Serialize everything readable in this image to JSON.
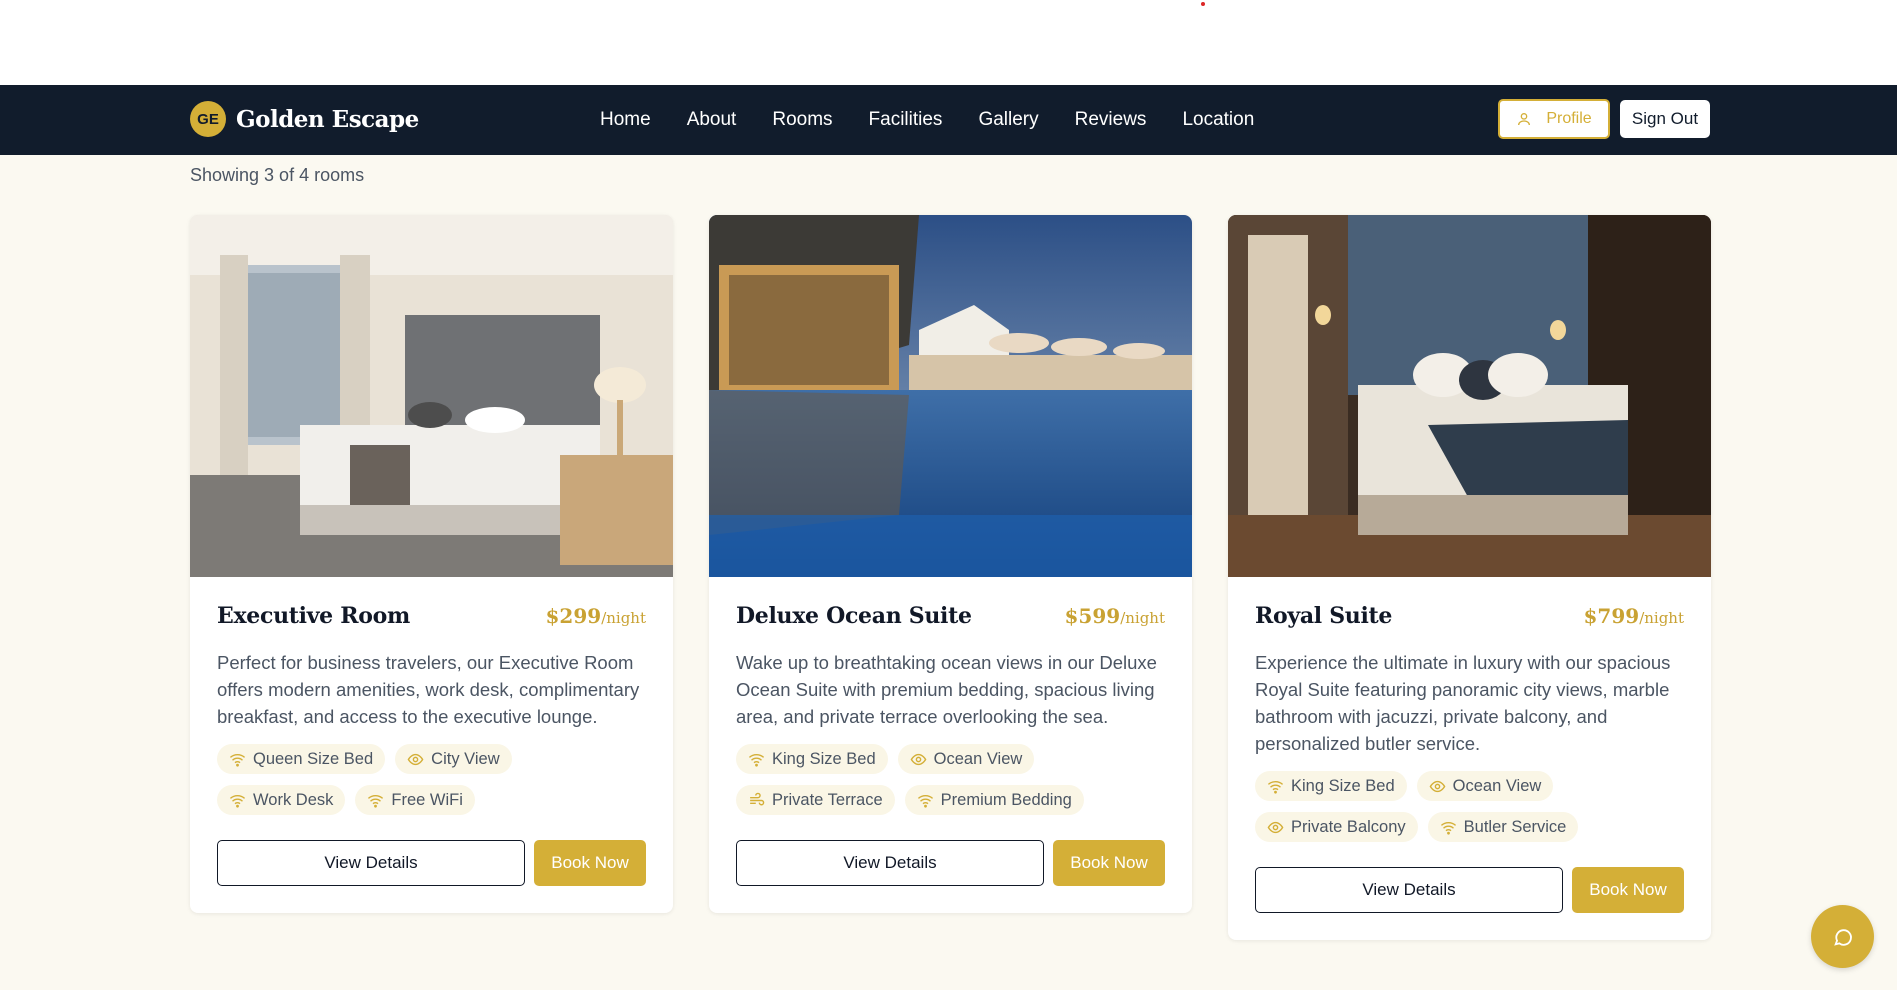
{
  "brand": {
    "badge": "GE",
    "name": "Golden Escape"
  },
  "nav": {
    "links": [
      "Home",
      "About",
      "Rooms",
      "Facilities",
      "Gallery",
      "Reviews",
      "Location"
    ],
    "profile_label": "Profile",
    "signout_label": "Sign Out"
  },
  "listing": {
    "count_text": "Showing 3 of 4 rooms",
    "rooms": [
      {
        "title": "Executive Room",
        "price": "$299",
        "price_unit": "/night",
        "description": "Perfect for business travelers, our Executive Room offers modern amenities, work desk, complimentary breakfast, and access to the executive lounge.",
        "amenities": [
          {
            "label": "Queen Size Bed",
            "icon": "wifi-icon"
          },
          {
            "label": "City View",
            "icon": "eye-icon"
          },
          {
            "label": "Work Desk",
            "icon": "wifi-icon"
          },
          {
            "label": "Free WiFi",
            "icon": "wifi-icon"
          }
        ],
        "view_label": "View Details",
        "book_label": "Book Now"
      },
      {
        "title": "Deluxe Ocean Suite",
        "price": "$599",
        "price_unit": "/night",
        "description": "Wake up to breathtaking ocean views in our Deluxe Ocean Suite with premium bedding, spacious living area, and private terrace overlooking the sea.",
        "amenities": [
          {
            "label": "King Size Bed",
            "icon": "wifi-icon"
          },
          {
            "label": "Ocean View",
            "icon": "eye-icon"
          },
          {
            "label": "Private Terrace",
            "icon": "wind-icon"
          },
          {
            "label": "Premium Bedding",
            "icon": "wifi-icon"
          }
        ],
        "view_label": "View Details",
        "book_label": "Book Now"
      },
      {
        "title": "Royal Suite",
        "price": "$799",
        "price_unit": "/night",
        "description": "Experience the ultimate in luxury with our spacious Royal Suite featuring panoramic city views, marble bathroom with jacuzzi, private balcony, and personalized butler service.",
        "amenities": [
          {
            "label": "King Size Bed",
            "icon": "wifi-icon"
          },
          {
            "label": "Ocean View",
            "icon": "eye-icon"
          },
          {
            "label": "Private Balcony",
            "icon": "eye-icon"
          },
          {
            "label": "Butler Service",
            "icon": "wifi-icon"
          }
        ],
        "view_label": "View Details",
        "book_label": "Book Now"
      }
    ]
  },
  "colors": {
    "navy": "#111c2c",
    "gold": "#d4af37",
    "cream": "#fbf9f1"
  }
}
